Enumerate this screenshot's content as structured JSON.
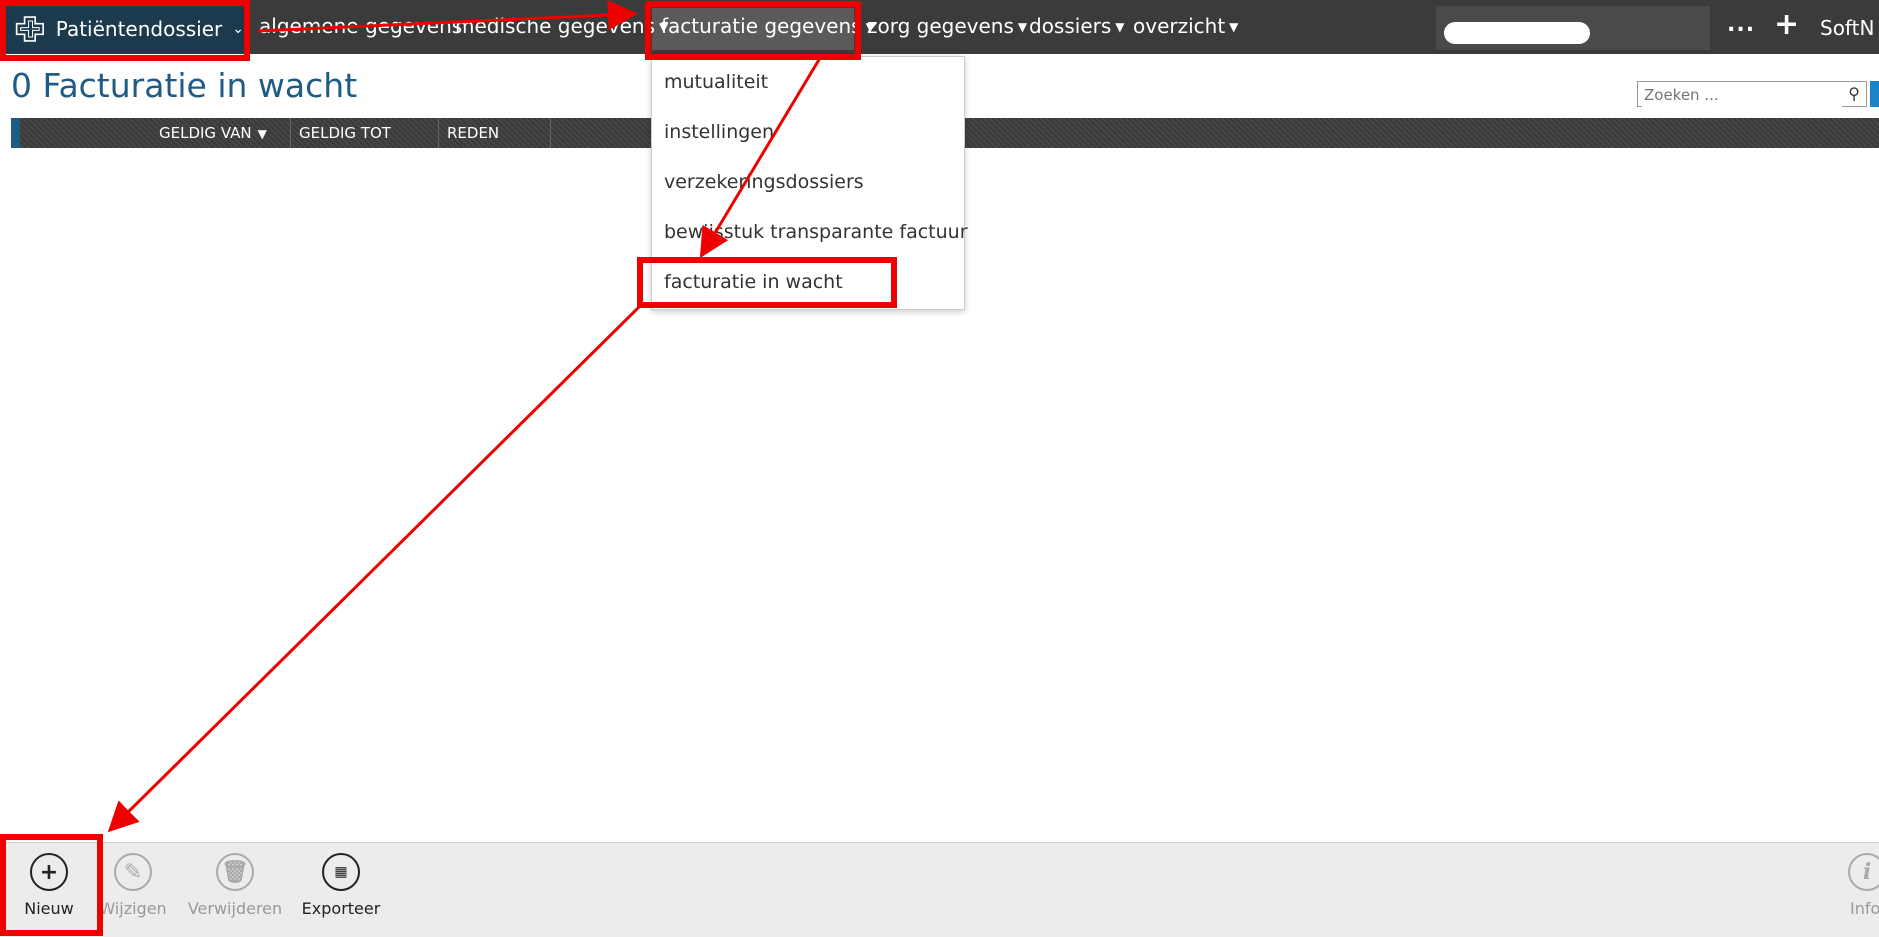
{
  "topbar": {
    "brand_label": "Patiëntendossier",
    "menu": [
      {
        "label": "algemene gegevens"
      },
      {
        "label": "medische gegevens"
      },
      {
        "label": "facturatie gegevens"
      },
      {
        "label": "zorg gegevens"
      },
      {
        "label": "dossiers"
      },
      {
        "label": "overzicht"
      }
    ],
    "more_label": "...",
    "add_label": "+",
    "user_label": "SoftN"
  },
  "page": {
    "title": "0 Facturatie in wacht",
    "search_placeholder": "Zoeken ..."
  },
  "grid": {
    "columns": [
      {
        "label": "GELDIG VAN",
        "sorted": true
      },
      {
        "label": "GELDIG TOT"
      },
      {
        "label": "REDEN"
      }
    ],
    "rows": []
  },
  "dropdown": {
    "items": [
      {
        "label": "mutualiteit"
      },
      {
        "label": "instellingen"
      },
      {
        "label": "verzekeringsdossiers"
      },
      {
        "label": "bewijsstuk transparante factuur"
      },
      {
        "label": "facturatie in wacht"
      }
    ]
  },
  "toolbar": {
    "buttons": [
      {
        "label": "Nieuw",
        "icon": "plus-icon",
        "enabled": true
      },
      {
        "label": "Wijzigen",
        "icon": "pencil-icon",
        "enabled": false
      },
      {
        "label": "Verwijderen",
        "icon": "trash-icon",
        "enabled": false
      },
      {
        "label": "Exporteer",
        "icon": "excel-icon",
        "enabled": true
      },
      {
        "label": "Info",
        "icon": "info-icon",
        "enabled": false
      }
    ]
  },
  "colors": {
    "topbar": "#3b3b3b",
    "brand": "#1c3a4d",
    "title": "#1f5c85",
    "annotation": "#ee0000"
  }
}
